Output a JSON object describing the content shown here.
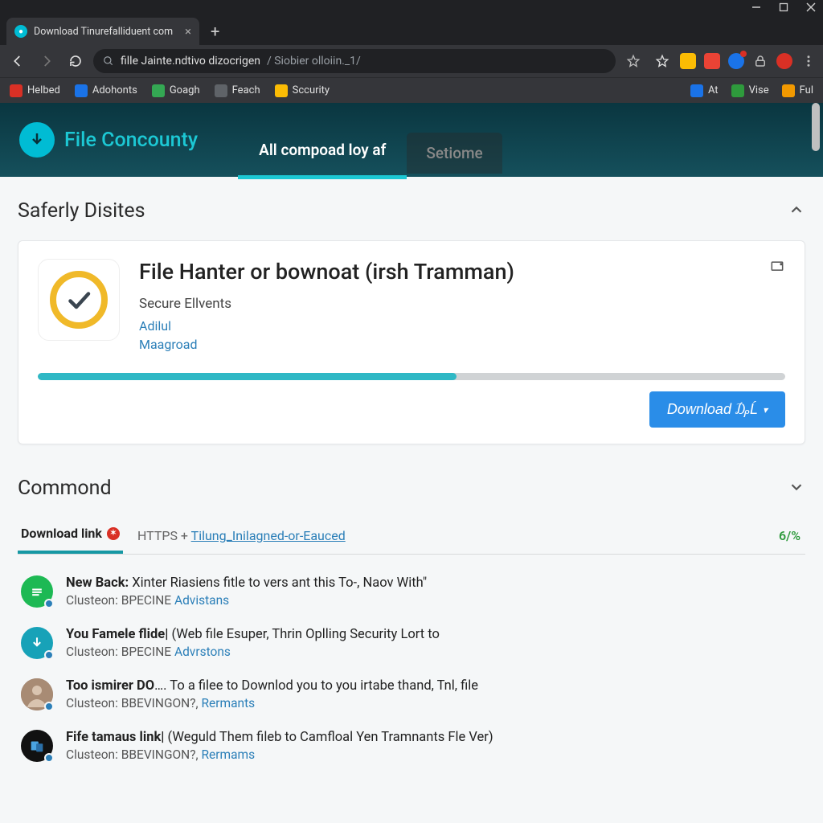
{
  "window": {
    "tab_title": "Download Tinurefalliduent com"
  },
  "omnibox": {
    "url_light": "fille Jainte.ndtivo dizocrigen",
    "url_grey": "/ Siobier olloiin._1/"
  },
  "bookmarks": {
    "left": [
      {
        "label": "Helbed",
        "color": "#d93025"
      },
      {
        "label": "Adohonts",
        "color": "#1a73e8"
      },
      {
        "label": "Goagh",
        "color": "#34a853"
      },
      {
        "label": "Feach",
        "color": "#5f6368"
      },
      {
        "label": "Sccurity",
        "color": "#fbbc04"
      }
    ],
    "right": [
      {
        "label": "At",
        "color": "#1a73e8"
      },
      {
        "label": "Vise",
        "color": "#2e9a3c"
      },
      {
        "label": "Ful",
        "color": "#f29900"
      }
    ]
  },
  "header": {
    "brand": "File Concounty",
    "tab_active": "All compoad loy af",
    "tab_inactive": "Setiome"
  },
  "section1": {
    "title": "Saferly Disites"
  },
  "card": {
    "title": "File Hanter or bownoat (irsh Tramman)",
    "subtitle": "Secure Ellvents",
    "link1": "Adilul",
    "link2": "Maagroad",
    "download_label": "Download ₯Ĺ"
  },
  "section2": {
    "title": "Commond",
    "tab_label": "Download link",
    "protocol": "HTTPS + ",
    "protocol_link": "Tilung_Inilagned-or-Eauced",
    "count": "6/%"
  },
  "items": [
    {
      "title": "New Back:",
      "rest": "  Xinter Riasiens fitle to vers ant this To-, Naov With\"",
      "sub_a": "Clusteon: BPECINE",
      "sub_b": "Advistans",
      "icon": "ic-green"
    },
    {
      "title": "You Famele flide|",
      "rest": " (Web file Esuper, Thrin Oplling Security Lort to",
      "sub_a": "Clusteon: BPECINE",
      "sub_b": "Advrstons",
      "icon": "ic-teal"
    },
    {
      "title": "Too ismirer DO",
      "rest": "…. To a filee to Downlod you to you irtabe thand, Tnl, file",
      "sub_a": "Clusteon: BBEVINGON?,",
      "sub_b": "Rermants",
      "icon": "ic-photo"
    },
    {
      "title": "Fife tamaus link|",
      "rest": " (Weguld Them fileb to Camfloal Yen Tramnants Fle Ver)",
      "sub_a": "Clusteon: BBEVINGON?,",
      "sub_b": "Rermams",
      "icon": "ic-black"
    }
  ]
}
